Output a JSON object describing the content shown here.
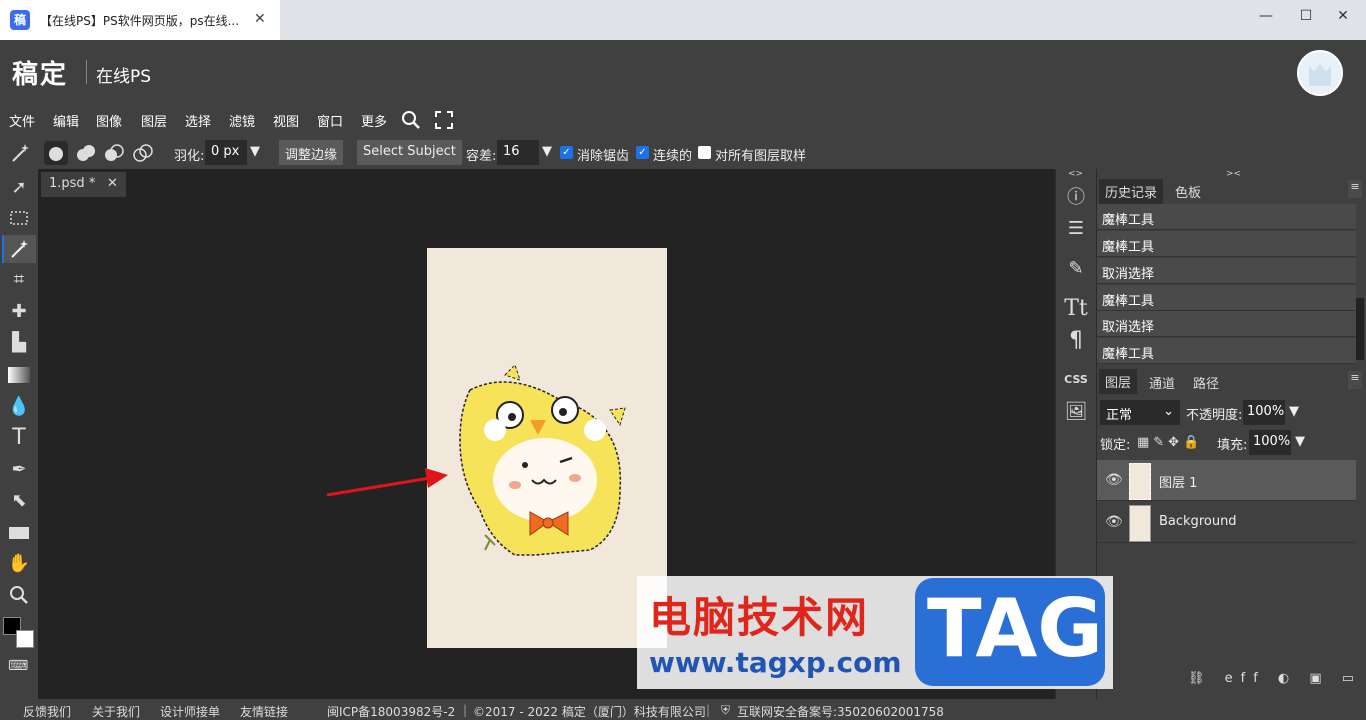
{
  "browser": {
    "tab_title": "【在线PS】PS软件网页版，ps在线...",
    "favicon_text": "稿",
    "close_glyph": "✕",
    "win_min": "—",
    "win_max": "☐",
    "win_close": "✕"
  },
  "header": {
    "brand": "稿定",
    "product": "在线PS"
  },
  "menu": [
    "文件",
    "编辑",
    "图像",
    "图层",
    "选择",
    "滤镜",
    "视图",
    "窗口",
    "更多"
  ],
  "options": {
    "feather_label": "羽化:",
    "feather_value": "0 px",
    "refine_edge": "调整边缘",
    "select_subject": "Select Subject",
    "tolerance_label": "容差:",
    "tolerance_value": "16",
    "antialias_label": "消除锯齿",
    "antialias_checked": true,
    "contiguous_label": "连续的",
    "contiguous_checked": true,
    "sample_all_label": "对所有图层取样",
    "sample_all_checked": false
  },
  "document": {
    "tab_label": "1.psd *",
    "tab_close": "✕",
    "background_color": "#f1e7da"
  },
  "history_panel": {
    "tabs": [
      "历史记录",
      "色板"
    ],
    "items": [
      "魔棒工具",
      "魔棒工具",
      "取消选择",
      "魔棒工具",
      "取消选择",
      "魔棒工具"
    ]
  },
  "layers_panel": {
    "tabs": [
      "图层",
      "通道",
      "路径"
    ],
    "blend_mode": "正常",
    "opacity_label": "不透明度:",
    "opacity_value": "100%",
    "lock_label": "锁定:",
    "fill_label": "填充:",
    "fill_value": "100%",
    "layers": [
      {
        "name": "图层 1",
        "selected": true
      },
      {
        "name": "Background",
        "selected": false
      }
    ]
  },
  "footer": {
    "links": [
      "反馈我们",
      "关于我们",
      "设计师接单",
      "友情链接"
    ],
    "icp": "闽ICP备18003982号-2",
    "copyright": "©2017 - 2022 稿定（厦门）科技有限公司",
    "security": "互联网安全备案号:35020602001758"
  },
  "watermark": {
    "title": "电脑技术网",
    "url": "www.tagxp.com",
    "tag": "TAG"
  },
  "colors": {
    "accent": "#1a73e8",
    "panel": "#404040",
    "workarea": "#232323"
  }
}
